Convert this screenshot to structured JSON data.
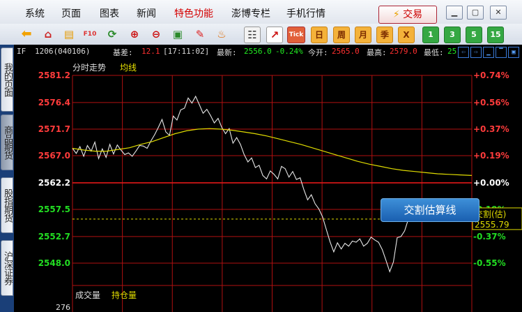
{
  "menu": {
    "items": [
      "系统",
      "页面",
      "图表",
      "新闻",
      "特色功能",
      "澎博专栏",
      "手机行情"
    ],
    "hot_index": 4,
    "trade_label": "交易",
    "trade_icon": "lightning-icon"
  },
  "toolbar": {
    "icons": [
      "back-arrow-icon",
      "home-icon",
      "notes-icon",
      "f10-icon",
      "refresh-icon",
      "zoom-in-icon",
      "zoom-out-icon",
      "window-icon",
      "pen-icon",
      "paint-icon",
      "table-icon",
      "line-chart-icon"
    ],
    "tick_label": "Tick",
    "periods": [
      "日",
      "周",
      "月",
      "季",
      "X"
    ],
    "minutes": [
      "1",
      "3",
      "5",
      "15"
    ]
  },
  "left_tabs": [
    {
      "label": "我的页面",
      "active": false
    },
    {
      "label": "商品期货",
      "active": true
    },
    {
      "label": "股指期货",
      "active": false
    },
    {
      "label": "沪深证券",
      "active": false
    }
  ],
  "quote": {
    "symbol": "IF",
    "code": "1206(040106)",
    "basis_label": "基差:",
    "basis_value": "12.1",
    "time": "[17:11:02]",
    "last_label": "最新:",
    "last_value": "2556.0",
    "change": "-0.24%",
    "open_label": "今开:",
    "open_value": "2565.0",
    "high_label": "最高:",
    "high_value": "2579.0",
    "low_label": "最低:",
    "low_value": "25"
  },
  "chart_data": {
    "type": "line",
    "legend": [
      "分时走势",
      "均线"
    ],
    "y_ticks": [
      "2581.2",
      "2576.4",
      "2571.7",
      "2567.0",
      "2562.2",
      "2557.5",
      "2552.7",
      "2548.0"
    ],
    "pct_ticks": [
      "+0.74%",
      "+0.56%",
      "+0.37%",
      "+0.19%",
      "+0.00%",
      "-0.19%",
      "-0.37%",
      "-0.55%"
    ],
    "ylim": [
      2548.0,
      2581.2
    ],
    "prev_close": 2562.2,
    "settle_label": "交割(估)",
    "settle_value": "2555.79",
    "overlay_label": "交割估算线",
    "lower_panel_labels": [
      "成交量",
      "持仓量"
    ],
    "lower_axis_label": "276",
    "series": [
      {
        "name": "分时走势",
        "values": [
          2568.3,
          2567.4,
          2568.6,
          2566.9,
          2568.8,
          2567.8,
          2569.4,
          2566.5,
          2568.2,
          2566.7,
          2569.0,
          2567.3,
          2568.9,
          2568.0,
          2567.2,
          2567.5,
          2566.9,
          2567.8,
          2568.8,
          2568.7,
          2568.3,
          2569.6,
          2570.7,
          2572.0,
          2573.4,
          2571.2,
          2570.6,
          2574.0,
          2573.3,
          2575.1,
          2575.4,
          2577.2,
          2576.3,
          2577.5,
          2576.0,
          2574.5,
          2575.2,
          2574.1,
          2572.8,
          2573.6,
          2572.0,
          2570.9,
          2571.8,
          2569.2,
          2570.2,
          2569.0,
          2567.2,
          2565.9,
          2566.6,
          2564.9,
          2565.3,
          2563.5,
          2562.9,
          2564.3,
          2563.7,
          2562.9,
          2565.1,
          2564.7,
          2563.2,
          2564.2,
          2562.8,
          2563.1,
          2561.0,
          2559.2,
          2560.1,
          2558.5,
          2557.6,
          2556.2,
          2554.0,
          2551.8,
          2550.0,
          2551.6,
          2550.5,
          2551.5,
          2551.0,
          2551.9,
          2551.7,
          2552.3,
          2551.0,
          2551.5,
          2552.6,
          2552.1,
          2551.7,
          2550.4,
          2548.5,
          2546.5,
          2548.2,
          2552.5,
          2552.7,
          2553.7,
          2555.8,
          2557.4,
          2556.2,
          2556.9,
          2555.7,
          2557.0,
          2555.6,
          2556.6,
          2557.3,
          2556.3,
          2556.8,
          2555.9,
          2556.5,
          2555.9,
          2556.1,
          2556.0,
          2556.0,
          2556.0
        ]
      },
      {
        "name": "均线",
        "values": [
          2568.3,
          2568.0,
          2567.8,
          2567.8,
          2568.1,
          2568.4,
          2569.0,
          2569.5,
          2570.2,
          2570.9,
          2571.4,
          2571.7,
          2571.8,
          2571.7,
          2571.5,
          2571.2,
          2570.9,
          2570.5,
          2570.0,
          2569.5,
          2569.0,
          2568.4,
          2567.8,
          2567.2,
          2566.6,
          2566.0,
          2565.5,
          2565.1,
          2564.7,
          2564.4,
          2564.2,
          2564.0,
          2563.8,
          2563.7,
          2563.6,
          2563.5
        ]
      }
    ]
  }
}
